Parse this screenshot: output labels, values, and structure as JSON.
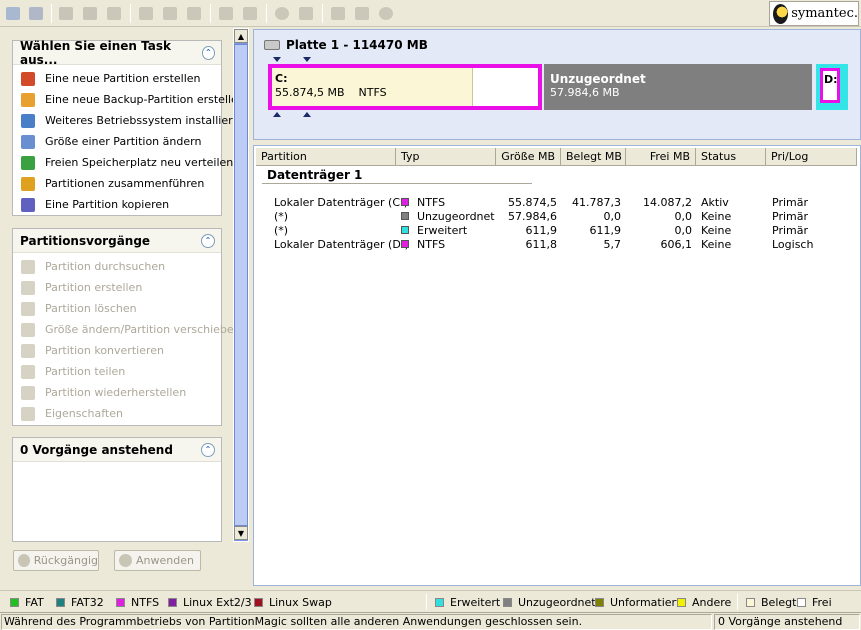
{
  "toolbar": {
    "buttons": [
      "move-partition-icon",
      "resize-icon",
      "wizard-icon",
      "delete-icon",
      "undo-icon",
      "copy-icon",
      "format-icon",
      "convert-icon",
      "split-icon",
      "merge-icon",
      "info-icon",
      "browse-icon",
      "back-icon",
      "redo-icon",
      "apply-icon"
    ],
    "brand": "symantec."
  },
  "tasks": {
    "title": "Wählen Sie einen Task aus...",
    "items": [
      {
        "label": "Eine neue Partition erstellen",
        "icon": "create-partition-icon",
        "color": "#d34a2a"
      },
      {
        "label": "Eine neue Backup-Partition erstellen",
        "icon": "backup-partition-icon",
        "color": "#e8a030"
      },
      {
        "label": "Weiteres Betriebssystem installieren",
        "icon": "install-os-icon",
        "color": "#4a7fc8"
      },
      {
        "label": "Größe einer Partition ändern",
        "icon": "resize-partition-icon",
        "color": "#6a8fd0"
      },
      {
        "label": "Freien Speicherplatz neu verteilen",
        "icon": "redistribute-icon",
        "color": "#3aa040"
      },
      {
        "label": "Partitionen zusammenführen",
        "icon": "merge-partitions-icon",
        "color": "#e0a020"
      },
      {
        "label": "Eine Partition kopieren",
        "icon": "copy-partition-icon",
        "color": "#6060c0"
      }
    ]
  },
  "operations": {
    "title": "Partitionsvorgänge",
    "items": [
      {
        "label": "Partition durchsuchen",
        "icon": "browse-partition-icon"
      },
      {
        "label": "Partition erstellen",
        "icon": "create-icon"
      },
      {
        "label": "Partition löschen",
        "icon": "delete-partition-icon"
      },
      {
        "label": "Größe ändern/Partition verschieben",
        "icon": "resize-move-icon"
      },
      {
        "label": "Partition konvertieren",
        "icon": "convert-partition-icon"
      },
      {
        "label": "Partition teilen",
        "icon": "split-partition-icon"
      },
      {
        "label": "Partition wiederherstellen",
        "icon": "restore-partition-icon"
      },
      {
        "label": "Eigenschaften",
        "icon": "properties-icon"
      }
    ]
  },
  "pending": {
    "title": "0 Vorgänge anstehend"
  },
  "buttons": {
    "undo": "Rückgängig",
    "apply": "Anwenden"
  },
  "disk": {
    "title": "Platte 1 - 114470 MB",
    "c": {
      "letter": "C:",
      "size": "55.874,5 MB",
      "fs": "NTFS"
    },
    "unallocated": {
      "label": "Unzugeordnet",
      "size": "57.984,6 MB"
    },
    "d": {
      "letter": "D:"
    }
  },
  "table": {
    "headers": [
      "Partition",
      "Typ",
      "Größe MB",
      "Belegt MB",
      "Frei MB",
      "Status",
      "Pri/Log"
    ],
    "group": "Datenträger 1",
    "rows": [
      {
        "partition": "Lokaler Datenträger (C:)",
        "typ": "NTFS",
        "color": "#e020e0",
        "size": "55.874,5",
        "used": "41.787,3",
        "free": "14.087,2",
        "status": "Aktiv",
        "prilog": "Primär"
      },
      {
        "partition": "(*)",
        "typ": "Unzugeordnet",
        "color": "#808080",
        "size": "57.984,6",
        "used": "0,0",
        "free": "0,0",
        "status": "Keine",
        "prilog": "Primär"
      },
      {
        "partition": "(*)",
        "typ": "Erweitert",
        "color": "#30e0e0",
        "size": "611,9",
        "used": "611,9",
        "free": "0,0",
        "status": "Keine",
        "prilog": "Primär"
      },
      {
        "partition": "Lokaler Datenträger (D:)",
        "typ": "NTFS",
        "color": "#e020e0",
        "size": "611,8",
        "used": "5,7",
        "free": "606,1",
        "status": "Keine",
        "prilog": "Logisch"
      }
    ]
  },
  "legend": [
    {
      "label": "FAT",
      "color": "#20c020"
    },
    {
      "label": "FAT32",
      "color": "#208080"
    },
    {
      "label": "NTFS",
      "color": "#e020e0"
    },
    {
      "label": "Linux Ext2/3",
      "color": "#8020a0"
    },
    {
      "label": "Linux Swap",
      "color": "#a01020"
    },
    {
      "label": "Erweitert",
      "color": "#30e0e0"
    },
    {
      "label": "Unzugeordnet",
      "color": "#808080"
    },
    {
      "label": "Unformatiert",
      "color": "#808000"
    },
    {
      "label": "Andere",
      "color": "#f0f000"
    },
    {
      "label": "Belegt",
      "color": "#fbf7d6"
    },
    {
      "label": "Frei",
      "color": "#ffffff"
    }
  ],
  "status": {
    "message": "Während des Programmbetriebs von PartitionMagic sollten alle anderen Anwendungen geschlossen sein.",
    "pending": "0 Vorgänge anstehend"
  }
}
